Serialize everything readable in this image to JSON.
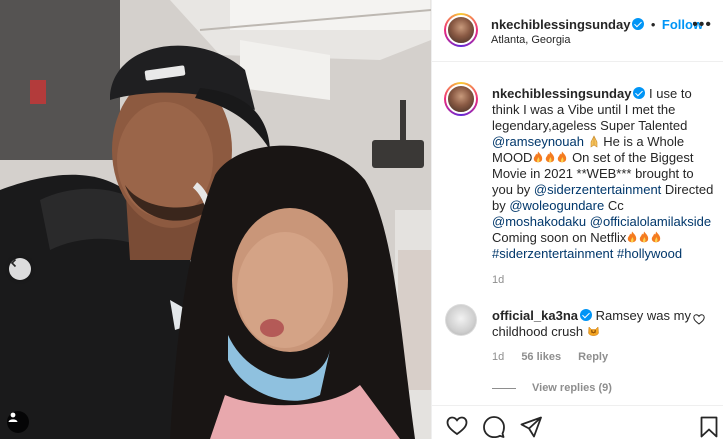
{
  "post": {
    "username": "nkechiblessingsunday",
    "follow_label": "Follow",
    "dot": "•",
    "location": "Atlanta, Georgia",
    "more": "•••"
  },
  "caption": {
    "username": "nkechiblessingsunday",
    "t1": " I use to think I was a Vibe until I met the legendary,ageless Super Talented ",
    "mention_ramsey": "@ramseynouah",
    "t2": " He is a Whole MOOD",
    "t3": " On set of the Biggest Movie in 2021 **WEB*** brought to you by ",
    "mention_siderz": "@siderzentertainment",
    "t4": " Directed by ",
    "mention_woleo": "@woleogundare",
    "t5": " Cc ",
    "mention_mosha": "@moshakodaku",
    "t6": " ",
    "mention_lola": "@officialolamilakside",
    "t7": " Coming soon on Netflix",
    "hashtag1": "#siderzentertainment",
    "hashtag2": "#hollywood",
    "age": "1d"
  },
  "comment": {
    "username": "official_ka3na",
    "text": " Ramsey was my childhood crush ",
    "age": "1d",
    "likes": "56 likes",
    "reply": "Reply",
    "view_replies": "View replies (9)"
  },
  "icons": [
    "chevron-left-icon",
    "tag-user-icon",
    "verified-icon",
    "more-icon",
    "heart-icon",
    "comment-icon",
    "share-icon",
    "bookmark-icon",
    "fire-emoji",
    "pray-emoji",
    "cat-emoji"
  ],
  "colors": {
    "link": "#00376b",
    "follow": "#0095f6",
    "muted": "#8e8e8e",
    "text": "#262626"
  }
}
